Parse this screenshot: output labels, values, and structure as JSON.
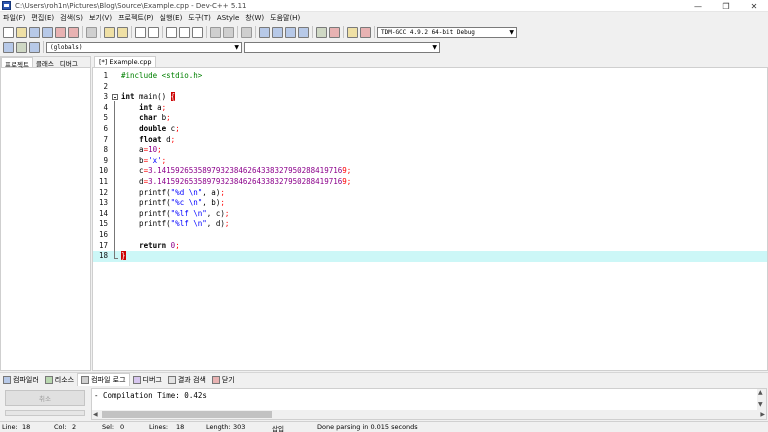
{
  "window": {
    "title": "C:\\Users\\roh1n\\Pictures\\Blog\\Source\\Example.cpp - Dev-C++ 5.11",
    "minimize": "—",
    "restore": "❐",
    "close": "✕"
  },
  "menu": [
    "파일(F)",
    "편집(E)",
    "검색(S)",
    "보기(V)",
    "프로젝트(P)",
    "실행(E)",
    "도구(T)",
    "AStyle",
    "창(W)",
    "도움말(H)"
  ],
  "toolbar": {
    "compiler_select": "TDM-GCC 4.9.2 64-bit Debug",
    "scope_select": "(globals)",
    "function_select": ""
  },
  "left_panel": {
    "tabs": [
      "프로젝트",
      "클래스",
      "디버그"
    ],
    "active_tab": 0
  },
  "editor": {
    "tab_label": "[*] Example.cpp",
    "current_line": 18,
    "lines": [
      {
        "n": "1",
        "tokens": [
          [
            "pp",
            "#include <stdio.h>"
          ]
        ]
      },
      {
        "n": "2",
        "tokens": []
      },
      {
        "n": "3",
        "tokens": [
          [
            "kw",
            "int"
          ],
          [
            "id",
            " main() "
          ],
          [
            "brace",
            "{"
          ]
        ]
      },
      {
        "n": "4",
        "tokens": [
          [
            "id",
            "    "
          ],
          [
            "kw",
            "int"
          ],
          [
            "id",
            " a"
          ],
          [
            "sym",
            ";"
          ]
        ]
      },
      {
        "n": "5",
        "tokens": [
          [
            "id",
            "    "
          ],
          [
            "kw",
            "char"
          ],
          [
            "id",
            " b"
          ],
          [
            "sym",
            ";"
          ]
        ]
      },
      {
        "n": "6",
        "tokens": [
          [
            "id",
            "    "
          ],
          [
            "kw",
            "double"
          ],
          [
            "id",
            " c"
          ],
          [
            "sym",
            ";"
          ]
        ]
      },
      {
        "n": "7",
        "tokens": [
          [
            "id",
            "    "
          ],
          [
            "kw",
            "float"
          ],
          [
            "id",
            " d"
          ],
          [
            "sym",
            ";"
          ]
        ]
      },
      {
        "n": "8",
        "tokens": [
          [
            "id",
            "    a"
          ],
          [
            "sym",
            "="
          ],
          [
            "num",
            "10"
          ],
          [
            "sym",
            ";"
          ]
        ]
      },
      {
        "n": "9",
        "tokens": [
          [
            "id",
            "    b"
          ],
          [
            "sym",
            "="
          ],
          [
            "str",
            "'x'"
          ],
          [
            "sym",
            ";"
          ]
        ]
      },
      {
        "n": "10",
        "tokens": [
          [
            "id",
            "    c"
          ],
          [
            "sym",
            "="
          ],
          [
            "num",
            "3.14159265358979323846264338327950288419716"
          ],
          [
            "sym",
            "9;"
          ]
        ]
      },
      {
        "n": "11",
        "tokens": [
          [
            "id",
            "    d"
          ],
          [
            "sym",
            "="
          ],
          [
            "num",
            "3.14159265358979323846264338327950288419716"
          ],
          [
            "sym",
            "9;"
          ]
        ]
      },
      {
        "n": "12",
        "tokens": [
          [
            "id",
            "    printf("
          ],
          [
            "str",
            "\"%d \\n\""
          ],
          [
            "id",
            ", a)"
          ],
          [
            "sym",
            ";"
          ]
        ]
      },
      {
        "n": "13",
        "tokens": [
          [
            "id",
            "    printf("
          ],
          [
            "str",
            "\"%c \\n\""
          ],
          [
            "id",
            ", b)"
          ],
          [
            "sym",
            ";"
          ]
        ]
      },
      {
        "n": "14",
        "tokens": [
          [
            "id",
            "    printf("
          ],
          [
            "str",
            "\"%lf \\n\""
          ],
          [
            "id",
            ", c)"
          ],
          [
            "sym",
            ";"
          ]
        ]
      },
      {
        "n": "15",
        "tokens": [
          [
            "id",
            "    printf("
          ],
          [
            "str",
            "\"%lf \\n\""
          ],
          [
            "id",
            ", d)"
          ],
          [
            "sym",
            ";"
          ]
        ]
      },
      {
        "n": "16",
        "tokens": []
      },
      {
        "n": "17",
        "tokens": [
          [
            "id",
            "    "
          ],
          [
            "kw",
            "return"
          ],
          [
            "id",
            " "
          ],
          [
            "num",
            "0"
          ],
          [
            "sym",
            ";"
          ]
        ]
      },
      {
        "n": "18",
        "tokens": [
          [
            "brace",
            "}"
          ]
        ]
      }
    ]
  },
  "bottom_tabs": [
    "컴파일러",
    "리소스",
    "컴파일 로그",
    "디버그",
    "결과 검색",
    "닫기"
  ],
  "bottom_active_tab": 2,
  "bottom_panel": {
    "abort_label": "취소",
    "log": "- Compilation Time: 0.42s"
  },
  "status": {
    "line_label": "Line:",
    "line_value": "18",
    "col_label": "Col:",
    "col_value": "2",
    "sel_label": "Sel:",
    "sel_value": "0",
    "lines_label": "Lines:",
    "lines_value": "18",
    "length_label": "Length:",
    "length_value": "303",
    "mode": "삽입",
    "message": "Done parsing in 0.015 seconds"
  }
}
